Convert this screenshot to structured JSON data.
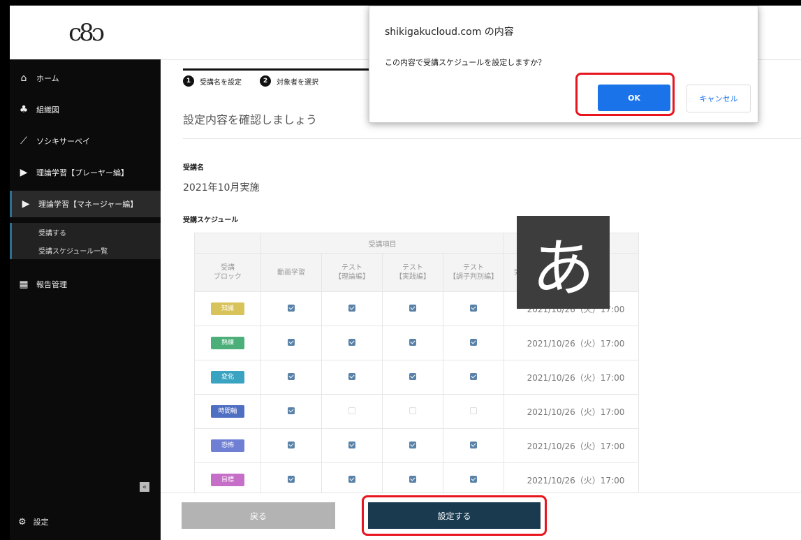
{
  "sidebar": {
    "logo": "c8ɔ",
    "items": [
      {
        "icon": "home-icon",
        "glyph": "⌂",
        "label": "ホーム"
      },
      {
        "icon": "org-icon",
        "glyph": "♣",
        "label": "組織図"
      },
      {
        "icon": "chart-icon",
        "glyph": "⟋",
        "label": "ソシキサーベイ"
      },
      {
        "icon": "play-icon",
        "glyph": "▶",
        "label": "理論学習【プレーヤー編】"
      },
      {
        "icon": "play-icon",
        "glyph": "▶",
        "label": "理論学習【マネージャー編】"
      },
      {
        "icon": "table-icon",
        "glyph": "▦",
        "label": "報告管理"
      }
    ],
    "sub_items": [
      {
        "label": "受講する"
      },
      {
        "label": "受講スケジュール一覧"
      }
    ],
    "collapse": "«",
    "settings_label": "設定",
    "settings_glyph": "⚙"
  },
  "stepper": {
    "steps": [
      {
        "num": "1",
        "label": "受講名を設定"
      },
      {
        "num": "2",
        "label": "対象者を選択"
      }
    ]
  },
  "main": {
    "heading": "設定内容を確認しましょう",
    "course_name_label": "受講名",
    "course_name_value": "2021年10月実施",
    "schedule_label": "受講スケジュール"
  },
  "table": {
    "group_header": "受講項目",
    "block_header": "受講\nブロック",
    "columns": [
      "動画学習",
      "テスト\n【理論編】",
      "テスト\n【実践編】",
      "テスト\n【調子判別編】"
    ],
    "due_header": "完了期限",
    "rows": [
      {
        "badge": "知識",
        "color": "#d8c35a",
        "checks": [
          true,
          true,
          true,
          true
        ],
        "due": "2021/10/26（火）17:00"
      },
      {
        "badge": "熟練",
        "color": "#4caf7a",
        "checks": [
          true,
          true,
          true,
          true
        ],
        "due": "2021/10/26（火）17:00"
      },
      {
        "badge": "変化",
        "color": "#3aa3c2",
        "checks": [
          true,
          true,
          true,
          true
        ],
        "due": "2021/10/26（火）17:00"
      },
      {
        "badge": "時間軸",
        "color": "#4f6fc2",
        "checks": [
          true,
          false,
          false,
          false
        ],
        "due": "2021/10/26（火）17:00"
      },
      {
        "badge": "恐怖",
        "color": "#6f7fd4",
        "checks": [
          true,
          true,
          true,
          true
        ],
        "due": "2021/10/26（火）17:00"
      },
      {
        "badge": "目標",
        "color": "#c56fc8",
        "checks": [
          true,
          true,
          true,
          true
        ],
        "due": "2021/10/26（火）17:00"
      }
    ]
  },
  "ime_char": "あ",
  "buttons": {
    "back": "戻る",
    "set": "設定する"
  },
  "dialog": {
    "title": "shikigakucloud.com の内容",
    "message": "この内容で受講スケジュールを設定しますか？",
    "ok": "OK",
    "cancel": "キャンセル"
  },
  "colors": {
    "accent": "#1a3a50",
    "ok_blue": "#1a73e8",
    "highlight": "#e8141e"
  }
}
